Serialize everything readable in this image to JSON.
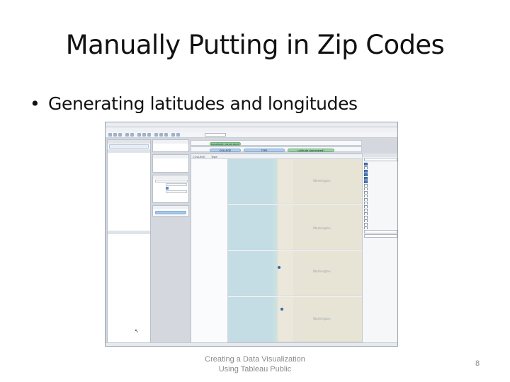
{
  "slide": {
    "title": "Manually Putting in Zip Codes",
    "bullet": "Generating latitudes and longitudes",
    "footer_line1": "Creating a Data Visualization",
    "footer_line2": "Using Tableau Public",
    "page_number": "8"
  },
  "screenshot": {
    "shelves": {
      "columns_pill": "Longitude (generated)",
      "rows_pill_1": "COLLEGE",
      "rows_pill_2": "TYPE",
      "rows_pill_3": "Latitude (generated)"
    },
    "row_labels": {
      "header_1": "COLLEGE",
      "header_2": "Type"
    },
    "map": {
      "region_label": "Washington",
      "dot_color": "#2f6db3"
    }
  }
}
